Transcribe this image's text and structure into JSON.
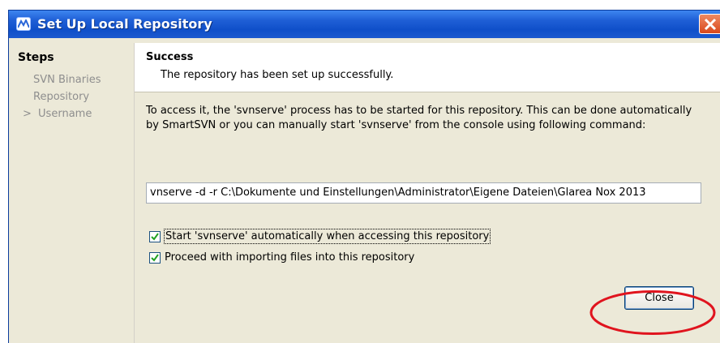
{
  "window": {
    "title": "Set Up Local Repository",
    "icon": "smartsvn-app-icon",
    "close_icon": "close-icon"
  },
  "sidebar": {
    "title": "Steps",
    "current_marker": ">",
    "items": [
      {
        "label": "SVN Binaries",
        "current": false
      },
      {
        "label": "Repository",
        "current": false
      },
      {
        "label": "Username",
        "current": true
      }
    ]
  },
  "header": {
    "title": "Success",
    "description": "The repository has been set up successfully."
  },
  "main": {
    "info_text": "To access it, the 'svnserve' process has to be started for this repository. This can be done automatically by SmartSVN or you can manually start 'svnserve' from the console using following command:",
    "command_value": "vnserve -d -r C:\\Dokumente und Einstellungen\\Administrator\\Eigene Dateien\\Glarea Nox 2013",
    "checkboxes": [
      {
        "label": "Start 'svnserve' automatically when accessing this repository",
        "checked": true
      },
      {
        "label": "Proceed with importing files into this repository",
        "checked": true
      }
    ],
    "close_button_label": "Close"
  },
  "colors": {
    "titlebar": "#0f4fc9",
    "dialog_bg": "#ece9d8",
    "annotation": "#e0141e",
    "disabled_text": "#8e8e8e"
  }
}
